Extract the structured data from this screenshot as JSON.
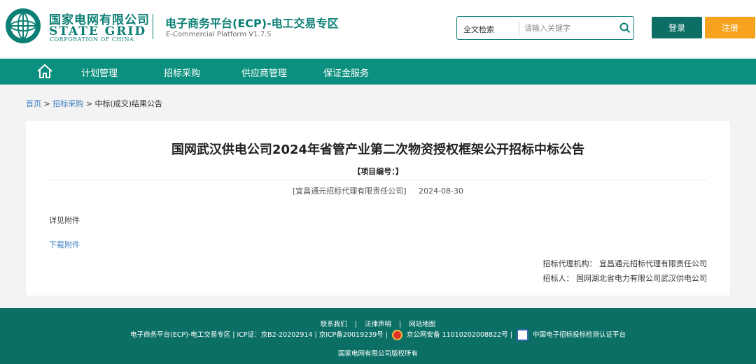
{
  "header": {
    "logo_cn": "国家电网有限公司",
    "logo_en": "STATE GRID",
    "logo_en_sub": "CORPORATION OF CHINA",
    "platform_title": "电子商务平台(ECP)-电工交易专区",
    "platform_sub": "E-Commercial Platform V1.7.5",
    "search_scope": "全文检索",
    "search_placeholder": "请输入关键字",
    "login_label": "登录",
    "register_label": "注册"
  },
  "nav": {
    "items": [
      "计划管理",
      "招标采购",
      "供应商管理",
      "保证金服务"
    ]
  },
  "breadcrumb": {
    "home": "首页",
    "sep1": ">",
    "level1": "招标采购",
    "sep2": ">",
    "current": "中标(成交)结果公告"
  },
  "notice": {
    "title": "国网武汉供电公司2024年省管产业第二次物资授权框架公开招标中标公告",
    "project_no": "【项目编号：】",
    "source": "[宜昌通元招标代理有限责任公司]",
    "date": "2024-08-30",
    "body": "详见附件",
    "download_label": "下载附件",
    "agency_label": "招标代理机构：",
    "agency_value": "宜昌通元招标代理有限责任公司",
    "tenderer_label": "招标人：",
    "tenderer_value": "国网湖北省电力有限公司武汉供电公司"
  },
  "footer": {
    "links": [
      "联系我们",
      "法律声明",
      "网站地图"
    ],
    "link_sep": "|",
    "row2_part1": "电子商务平台(ECP)-电工交易专区 | ICP证：京B2-20202914 | 京ICP备20019239号 |",
    "row2_part2": "京公网安备 11010202008822号 |",
    "row2_part3": "中国电子招标投标检测认证平台",
    "copyright": "国家电网有限公司版权所有"
  },
  "colors": {
    "brand_green": "#0b8f7e",
    "dark_green": "#0b6f66",
    "register_orange": "#f6a21e",
    "link_blue": "#3b7fc4"
  }
}
